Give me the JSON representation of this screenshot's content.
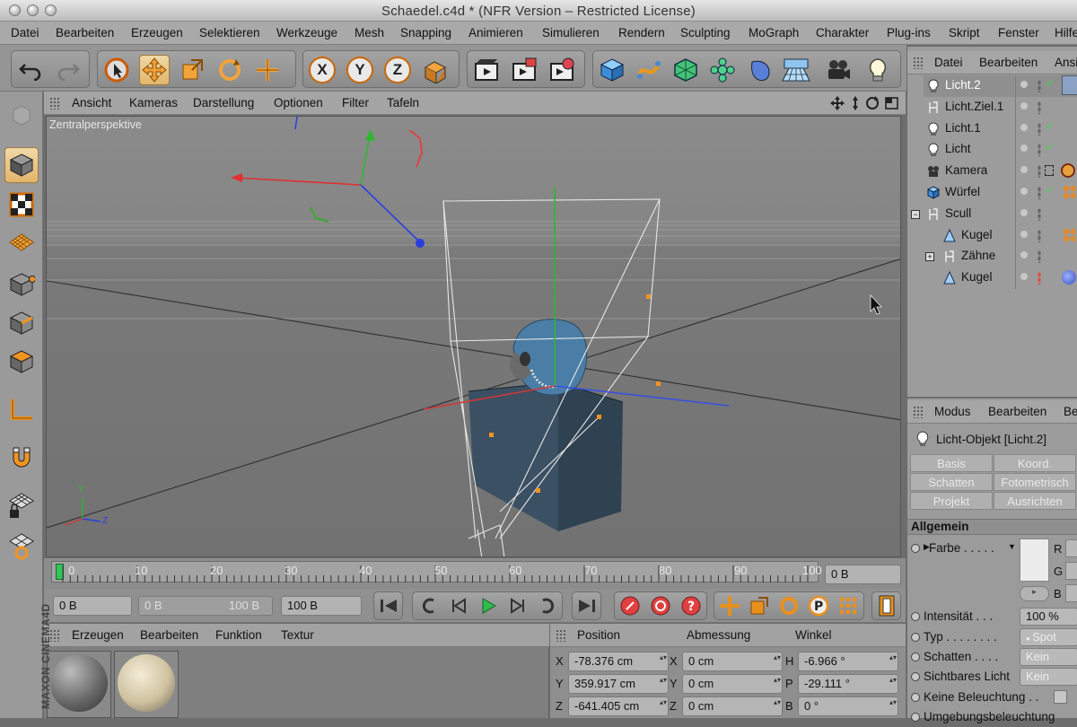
{
  "window": {
    "title": "Schaedel.c4d * (NFR Version – Restricted License)"
  },
  "menubar": [
    "Datei",
    "Bearbeiten",
    "Erzeugen",
    "Selektieren",
    "Werkzeuge",
    "Mesh",
    "Snapping",
    "Animieren",
    "Simulieren",
    "Rendern",
    "Sculpting",
    "MoGraph",
    "Charakter",
    "Plug-ins",
    "Skript",
    "Fenster",
    "Hilfe"
  ],
  "toolbar": {
    "icons": [
      "undo-icon",
      "redo-icon",
      "live-selection-icon",
      "move-icon",
      "scale-icon",
      "rotate-icon",
      "move-last-icon",
      "x-axis-icon",
      "y-axis-icon",
      "z-axis-icon",
      "world-coords-icon",
      "render-view-icon",
      "render-picture-viewer-icon",
      "render-settings-icon",
      "cube-primitive-icon",
      "spline-icon",
      "subdivision-icon",
      "cloner-icon",
      "deformer-icon",
      "floor-icon",
      "camera-icon",
      "light-icon"
    ],
    "axes": [
      "X",
      "Y",
      "Z"
    ]
  },
  "viewport": {
    "menu": [
      "Ansicht",
      "Kameras",
      "Darstellung",
      "Optionen",
      "Filter",
      "Tafeln"
    ],
    "label": "Zentralperspektive",
    "axis_y": "Y",
    "axis_z": "Z"
  },
  "timeline": {
    "ticks": [
      "0",
      "10",
      "20",
      "30",
      "40",
      "50",
      "60",
      "70",
      "80",
      "90",
      "100"
    ],
    "current_frame": "0 B"
  },
  "transport": {
    "start_field": "0 B",
    "range_start": "0 B",
    "range_end": "100 B",
    "end_field": "100 B"
  },
  "materials": {
    "menu": [
      "Erzeugen",
      "Bearbeiten",
      "Funktion",
      "Textur"
    ],
    "branding": "MAXON CINEMA4D"
  },
  "coordinates": {
    "headers": [
      "Position",
      "Abmessung",
      "Winkel"
    ],
    "rows": [
      {
        "axis": "X",
        "position": "-78.376 cm",
        "size_axis": "X",
        "size": "0 cm",
        "angle_axis": "H",
        "angle": "-6.966 °"
      },
      {
        "axis": "Y",
        "position": "359.917 cm",
        "size_axis": "Y",
        "size": "0 cm",
        "angle_axis": "P",
        "angle": "-29.111 °"
      },
      {
        "axis": "Z",
        "position": "-641.405 cm",
        "size_axis": "Z",
        "size": "0 cm",
        "angle_axis": "B",
        "angle": "0 °"
      }
    ]
  },
  "objects": {
    "menu": [
      "Datei",
      "Bearbeiten",
      "Ansicht"
    ],
    "items": [
      {
        "name": "Licht.2",
        "icon": "light-icon",
        "selected": true
      },
      {
        "name": "Licht.Ziel.1",
        "icon": "null-object-icon"
      },
      {
        "name": "Licht.1",
        "icon": "light-icon"
      },
      {
        "name": "Licht",
        "icon": "light-icon"
      },
      {
        "name": "Kamera",
        "icon": "camera-icon"
      },
      {
        "name": "Würfel",
        "icon": "cube-icon"
      },
      {
        "name": "Scull",
        "icon": "null-object-icon"
      },
      {
        "name": "Kugel",
        "icon": "polygon-object-icon"
      },
      {
        "name": "Zähne",
        "icon": "null-object-icon"
      },
      {
        "name": "Kugel",
        "icon": "polygon-object-icon"
      }
    ]
  },
  "attributes": {
    "menu": [
      "Modus",
      "Bearbeiten",
      "Benutzer"
    ],
    "object_title": "Licht-Objekt [Licht.2]",
    "tabs": [
      "Basis",
      "Koord.",
      "Schatten",
      "Fotometrisch",
      "Projekt",
      "Ausrichten"
    ],
    "section": "Allgemein",
    "farbe": "Farbe . . . . .",
    "rgb_labels": [
      "R",
      "G",
      "B"
    ],
    "intensitaet_label": "Intensität . . .",
    "intensitaet_value": "100 %",
    "typ_label": "Typ . . . . . . . .",
    "typ_value": "Spot",
    "schatten_label": "Schatten . . . .",
    "schatten_value": "Kein",
    "sichtbares_label": "Sichtbares Licht",
    "sichtbares_value": "Kein",
    "keine_label": "Keine Beleuchtung . .",
    "umgebung_label": "Umgebungsbeleuchtung"
  },
  "colors": {
    "accent_orange": "#e07a10",
    "selection": "#e2b56a",
    "highlight_text": "#ffffff"
  }
}
